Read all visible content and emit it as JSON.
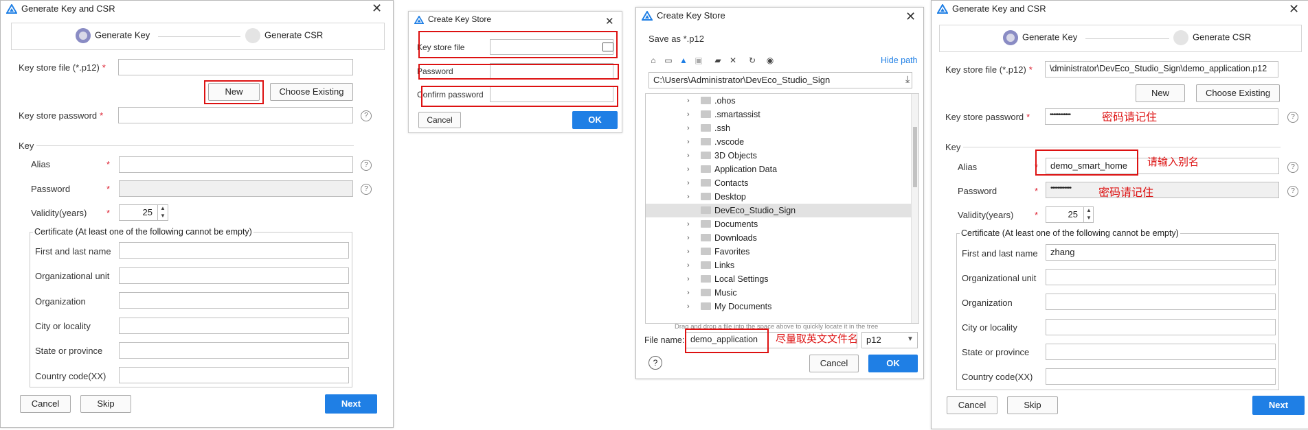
{
  "colors": {
    "accent": "#1f7fe5",
    "annotation_red": "#d11111"
  },
  "dialog1": {
    "title": "Generate Key and CSR",
    "steps": [
      "Generate Key",
      "Generate CSR"
    ],
    "keystore_label": "Key store file (*.p12)",
    "keystore_value": "",
    "new_label": "New",
    "choose_existing_label": "Choose Existing",
    "keystore_password_label": "Key store password",
    "key_section": "Key",
    "alias_label": "Alias",
    "password_label": "Password",
    "validity_label": "Validity(years)",
    "validity_value": "25",
    "cert_legend": "Certificate (At least one of the following cannot be empty)",
    "cert_fields": [
      "First and last name",
      "Organizational unit",
      "Organization",
      "City or locality",
      "State or province",
      "Country code(XX)"
    ],
    "cancel": "Cancel",
    "skip": "Skip",
    "next": "Next"
  },
  "dialog2": {
    "title": "Create Key Store",
    "keystore_label": "Key store file",
    "password_label": "Password",
    "confirm_label": "Confirm password",
    "cancel": "Cancel",
    "ok": "OK"
  },
  "dialog3": {
    "title": "Create Key Store",
    "subtitle": "Save as *.p12",
    "hide_path": "Hide path",
    "path": "C:\\Users\\Administrator\\DevEco_Studio_Sign",
    "tree": [
      ".ohos",
      ".smartassist",
      ".ssh",
      ".vscode",
      "3D Objects",
      "Application Data",
      "Contacts",
      "Desktop",
      "DevEco_Studio_Sign",
      "Documents",
      "Downloads",
      "Favorites",
      "Links",
      "Local Settings",
      "Music",
      "My Documents"
    ],
    "selected_item": "DevEco_Studio_Sign",
    "drag_hint": "Drag and drop a file into the space above to quickly locate it in the tree",
    "file_name_label": "File name:",
    "file_name_value": "demo_application",
    "file_type": "p12",
    "annotation": "尽量取英文文件名",
    "help": "?",
    "cancel": "Cancel",
    "ok": "OK"
  },
  "dialog4": {
    "title": "Generate Key and CSR",
    "steps": [
      "Generate Key",
      "Generate CSR"
    ],
    "keystore_label": "Key store file (*.p12)",
    "keystore_value": "\\dministrator\\DevEco_Studio_Sign\\demo_application.p12",
    "new_label": "New",
    "choose_existing_label": "Choose Existing",
    "keystore_password_label": "Key store password",
    "keystore_password_value": "••••••••••••",
    "keystore_password_note": "密码请记住",
    "key_section": "Key",
    "alias_label": "Alias",
    "alias_value": "demo_smart_home",
    "alias_note": "请输入别名",
    "password_label": "Password",
    "password_value": "••••••••••••",
    "password_note": "密码请记住",
    "validity_label": "Validity(years)",
    "validity_value": "25",
    "cert_legend": "Certificate (At least one of the following cannot be empty)",
    "cert_fields": [
      "First and last name",
      "Organizational unit",
      "Organization",
      "City or locality",
      "State or province",
      "Country code(XX)"
    ],
    "cert_values": [
      "zhang",
      "",
      "",
      "",
      "",
      ""
    ],
    "cancel": "Cancel",
    "skip": "Skip",
    "next": "Next"
  }
}
